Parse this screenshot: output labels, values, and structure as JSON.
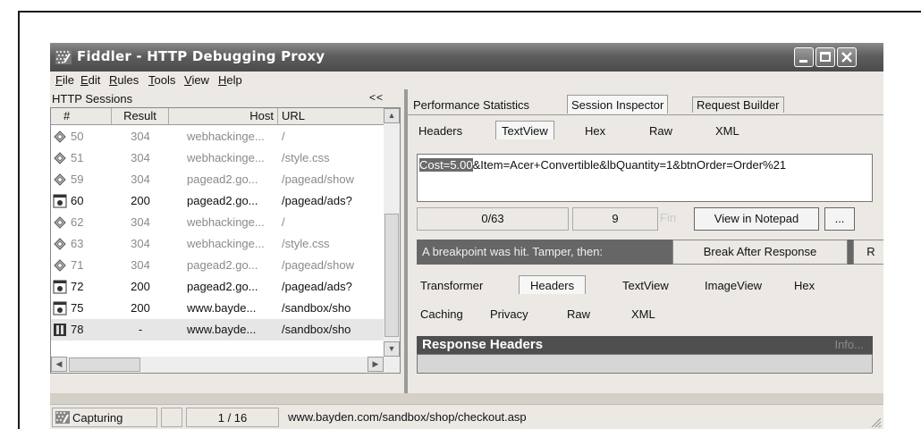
{
  "window": {
    "title": "Fiddler - HTTP Debugging Proxy"
  },
  "menu": [
    "File",
    "Edit",
    "Rules",
    "Tools",
    "View",
    "Help"
  ],
  "sessions": {
    "label": "HTTP Sessions",
    "collapse": "<<",
    "columns": [
      "#",
      "Result",
      "Host",
      "URL"
    ],
    "rows": [
      {
        "id": "50",
        "result": "304",
        "host": "webhackinge...",
        "url": "/",
        "icon": "cached-icon"
      },
      {
        "id": "51",
        "result": "304",
        "host": "webhackinge...",
        "url": "/style.css",
        "icon": "cached-icon"
      },
      {
        "id": "59",
        "result": "304",
        "host": "pagead2.go...",
        "url": "/pagead/show",
        "icon": "cached-icon"
      },
      {
        "id": "60",
        "result": "200",
        "host": "pagead2.go...",
        "url": "/pagead/ads?",
        "icon": "script-icon"
      },
      {
        "id": "62",
        "result": "304",
        "host": "webhackinge...",
        "url": "/",
        "icon": "cached-icon"
      },
      {
        "id": "63",
        "result": "304",
        "host": "webhackinge...",
        "url": "/style.css",
        "icon": "cached-icon"
      },
      {
        "id": "71",
        "result": "304",
        "host": "pagead2.go...",
        "url": "/pagead/show",
        "icon": "cached-icon"
      },
      {
        "id": "72",
        "result": "200",
        "host": "pagead2.go...",
        "url": "/pagead/ads?",
        "icon": "script-icon"
      },
      {
        "id": "75",
        "result": "200",
        "host": "www.bayde...",
        "url": "/sandbox/sho",
        "icon": "script-icon"
      },
      {
        "id": "78",
        "result": "-",
        "host": "www.bayde...",
        "url": "/sandbox/sho",
        "icon": "breakpoint-icon"
      }
    ]
  },
  "inspector": {
    "top_tabs": [
      "Performance Statistics",
      "Session Inspector",
      "Request Builder"
    ],
    "request_tabs": [
      "Headers",
      "TextView",
      "Hex",
      "Raw",
      "XML"
    ],
    "request_body_highlight": "Cost=5.00",
    "request_body_rest": "&Item=Acer+Convertible&lbQuantity=1&btnOrder=Order%21",
    "position": "0/63",
    "count": "9",
    "find": "Fin",
    "view_notepad": "View in Notepad",
    "ellipsis": "...",
    "breakpoint_text": "A breakpoint was hit.  Tamper, then:",
    "break_after_response": "Break After Response",
    "run_to_completion": "R",
    "response_tabs_row1": [
      "Transformer",
      "Headers",
      "TextView",
      "ImageView",
      "Hex"
    ],
    "response_tabs_row2": [
      "Caching",
      "Privacy",
      "Raw",
      "XML"
    ],
    "response_headers_title": "Response Headers",
    "info": "Info..."
  },
  "status": {
    "capturing": "Capturing",
    "count": "1 / 16",
    "url": "www.bayden.com/sandbox/shop/checkout.asp"
  }
}
